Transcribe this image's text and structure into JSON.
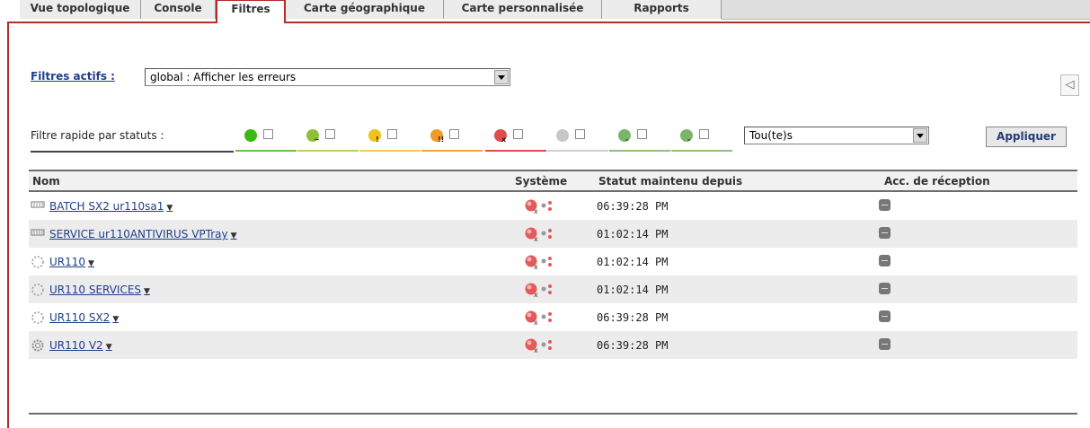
{
  "tabs": [
    {
      "label": "Vue topologique",
      "active": false
    },
    {
      "label": "Console",
      "active": false
    },
    {
      "label": "Filtres",
      "active": true
    },
    {
      "label": "Carte géographique",
      "active": false
    },
    {
      "label": "Carte personnalisée",
      "active": false
    },
    {
      "label": "Rapports",
      "active": false
    }
  ],
  "active_filters": {
    "label": "Filtres actifs :",
    "value": "global : Afficher les erreurs"
  },
  "quick_filter": {
    "label": "Filtre rapide par statuts :",
    "statuses": [
      {
        "icon": "status-ok-icon",
        "color": "#3cb815",
        "mark": "",
        "bar_color": "#6cc24a"
      },
      {
        "icon": "status-warning-icon",
        "color": "#8fbf3a",
        "mark": "~",
        "bar_color": "#b5d36b"
      },
      {
        "icon": "status-minor-icon",
        "color": "#f0c21a",
        "mark": "!",
        "bar_color": "#f2cf52"
      },
      {
        "icon": "status-major-icon",
        "color": "#f19a2a",
        "mark": "!!",
        "bar_color": "#f0a542"
      },
      {
        "icon": "status-critical-icon",
        "color": "#e14b4b",
        "mark": "x",
        "bar_color": "#e14b4b"
      },
      {
        "icon": "status-unknown-icon",
        "color": "#c7c7c7",
        "mark": "",
        "bar_color": "#cfcfcf"
      },
      {
        "icon": "status-maintenance-icon",
        "color": "#7bb56a",
        "mark": "-",
        "bar_color": "#8cc07b"
      },
      {
        "icon": "status-unmanaged-icon",
        "color": "#7bb56a",
        "mark": "-",
        "bar_color": "#8cc07b"
      }
    ],
    "select_value": "Tou(te)s",
    "apply_label": "Appliquer"
  },
  "table": {
    "columns": [
      "Nom",
      "Système",
      "Statut maintenu depuis",
      "Acc. de réception"
    ],
    "rows": [
      {
        "type": "batch-icon",
        "name": "BATCH SX2 ur110sa1",
        "time": "06:39:28 PM"
      },
      {
        "type": "batch-icon",
        "name": "SERVICE ur110ANTIVIRUS VPTray",
        "time": "01:02:14 PM"
      },
      {
        "type": "host-dotted-icon",
        "name": "UR110",
        "time": "01:02:14 PM"
      },
      {
        "type": "host-dotted-icon",
        "name": "UR110 SERVICES",
        "time": "01:02:14 PM"
      },
      {
        "type": "host-dotted-icon",
        "name": "UR110 SX2",
        "time": "06:39:28 PM"
      },
      {
        "type": "gear-icon",
        "name": "UR110 V2",
        "time": "06:39:28 PM"
      }
    ]
  }
}
